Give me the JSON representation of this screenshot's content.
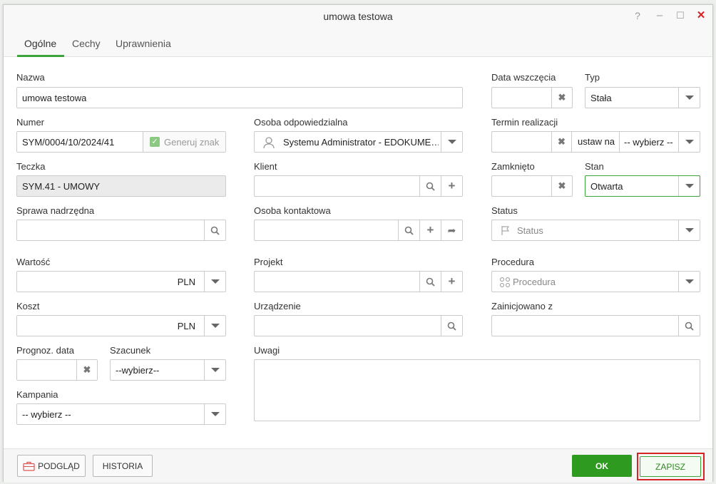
{
  "window": {
    "title": "umowa testowa",
    "help": "?",
    "minimize": "–",
    "maximize": "☐",
    "close": "✕"
  },
  "tabs": [
    "Ogólne",
    "Cechy",
    "Uprawnienia"
  ],
  "fields": {
    "nazwa": {
      "label": "Nazwa",
      "value": "umowa testowa"
    },
    "data_wszczecia": {
      "label": "Data wszczęcia",
      "value": ""
    },
    "typ": {
      "label": "Typ",
      "value": "Stała"
    },
    "numer": {
      "label": "Numer",
      "value": "SYM/0004/10/2024/41",
      "generate_label": "Generuj znak"
    },
    "osoba_odpowiedzialna": {
      "label": "Osoba odpowiedzialna",
      "value": "Systemu Administrator - EDOKUME…"
    },
    "termin_realizacji": {
      "label": "Termin realizacji",
      "value": "",
      "set_label": "ustaw na",
      "select_value": "-- wybierz --"
    },
    "teczka": {
      "label": "Teczka",
      "value": "SYM.41 - UMOWY"
    },
    "klient": {
      "label": "Klient",
      "value": ""
    },
    "zamknieto": {
      "label": "Zamknięto",
      "value": ""
    },
    "stan": {
      "label": "Stan",
      "value": "Otwarta"
    },
    "sprawa_nadrzedna": {
      "label": "Sprawa nadrzędna",
      "value": ""
    },
    "osoba_kontaktowa": {
      "label": "Osoba kontaktowa",
      "value": ""
    },
    "status": {
      "label": "Status",
      "placeholder": "Status"
    },
    "wartosc": {
      "label": "Wartość",
      "currency": "PLN"
    },
    "projekt": {
      "label": "Projekt",
      "value": ""
    },
    "procedura": {
      "label": "Procedura",
      "placeholder": "Procedura"
    },
    "koszt": {
      "label": "Koszt",
      "currency": "PLN"
    },
    "urzadzenie": {
      "label": "Urządzenie",
      "value": ""
    },
    "zainicjowano_z": {
      "label": "Zainicjowano z",
      "value": ""
    },
    "prognoz_data": {
      "label": "Prognoz. data",
      "value": ""
    },
    "szacunek": {
      "label": "Szacunek",
      "value": "--wybierz--"
    },
    "uwagi": {
      "label": "Uwagi",
      "value": ""
    },
    "kampania": {
      "label": "Kampania",
      "value": "-- wybierz --"
    }
  },
  "footer": {
    "preview": "PODGLĄD",
    "history": "HISTORIA",
    "ok": "OK",
    "save": "ZAPISZ"
  },
  "colors": {
    "accent": "#3aa33a",
    "ok_button": "#2e9a1f",
    "highlight": "#d52222"
  }
}
